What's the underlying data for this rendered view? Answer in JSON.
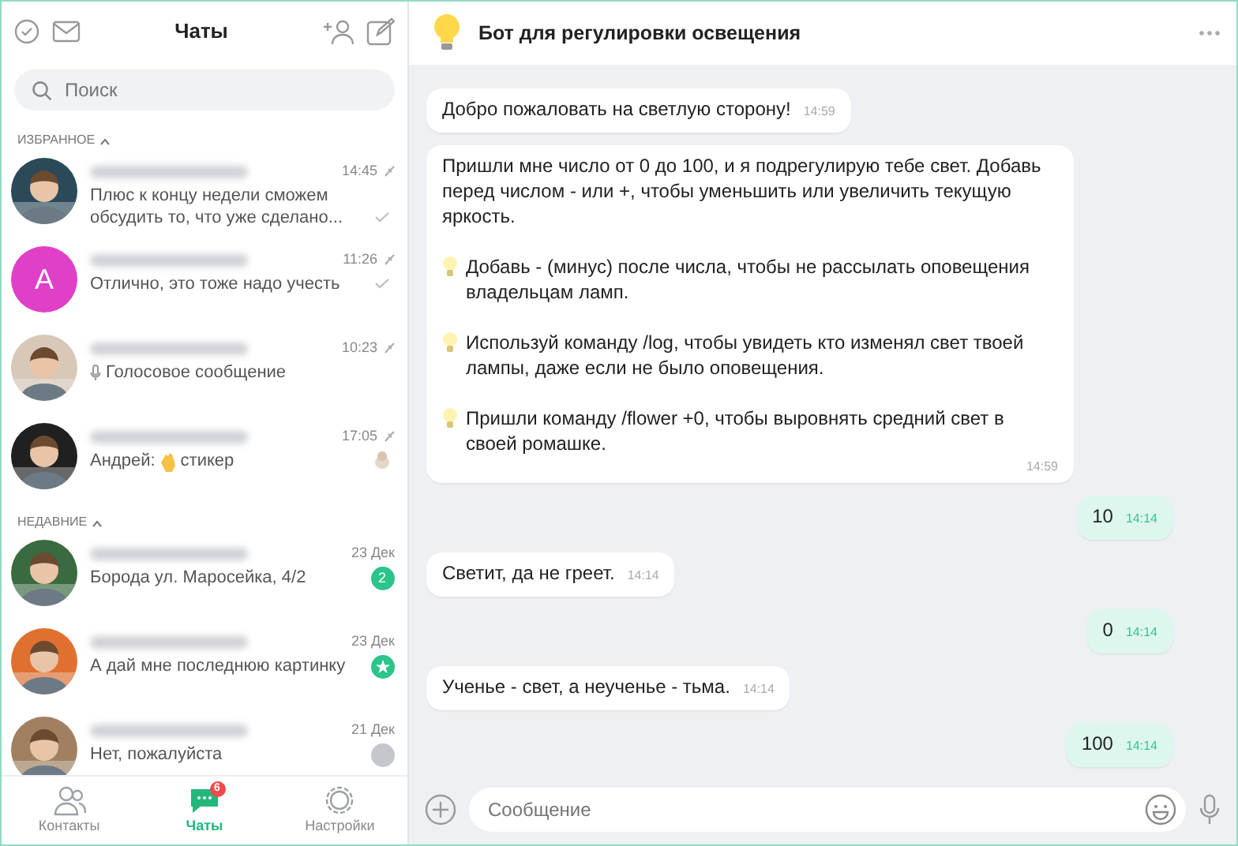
{
  "sidebar": {
    "title": "Чаты",
    "search": {
      "placeholder": "Поиск"
    },
    "sections": [
      {
        "title": "ИЗБРАННОЕ",
        "expanded": true,
        "chats": [
          {
            "message": "Плюс к концу недели сможем обсудить то, что уже сделано...",
            "time": "14:45",
            "pinned": true,
            "indicator": {
              "kind": "read"
            }
          },
          {
            "avatar": {
              "kind": "letter",
              "letter": "А",
              "color": "#e040c8"
            },
            "message": "Отлично, это тоже надо учесть",
            "time": "11:26",
            "pinned": true,
            "indicator": {
              "kind": "read"
            }
          },
          {
            "prefix": {
              "kind": "voice"
            },
            "message": "Голосовое сообщение",
            "time": "10:23",
            "pinned": true
          },
          {
            "sender": "Андрей:",
            "prefix": {
              "kind": "sticker"
            },
            "message": "стикер",
            "time": "17:05",
            "pinned": true,
            "indicator": {
              "kind": "thumbnail"
            }
          }
        ]
      },
      {
        "title": "НЕДАВНИЕ",
        "expanded": true,
        "chats": [
          {
            "message": "Борода ул. Маросейка, 4/2",
            "time": "23 Дек",
            "pinned": false,
            "indicator": {
              "kind": "count",
              "count": "2"
            }
          },
          {
            "message": "А дай мне последнюю картинку",
            "time": "23 Дек",
            "pinned": false,
            "indicator": {
              "kind": "mention"
            }
          },
          {
            "message": "Нет, пожалуйста",
            "time": "21 Дек",
            "pinned": false,
            "indicator": {
              "kind": "muted"
            }
          }
        ]
      }
    ]
  },
  "tabs": [
    {
      "label": "Контакты",
      "kind": "contacts",
      "selected": false
    },
    {
      "label": "Чаты",
      "kind": "chats",
      "selected": true,
      "badge": "6"
    },
    {
      "label": "Настройки",
      "kind": "settings",
      "selected": false
    }
  ],
  "chat": {
    "title": "Бот для регулировки освещения",
    "messages": [
      {
        "kind": "incoming",
        "paragraphs": [
          {
            "text": "Добро пожаловать на светлую сторону!",
            "bulb": false
          }
        ],
        "time": "14:59"
      },
      {
        "kind": "incoming",
        "paragraphs": [
          {
            "text": "Пришли мне число от 0 до 100, и я подрегулирую тебе свет. Добавь перед числом - или +, чтобы уменьшить или увеличить текущую яркость.",
            "bulb": false
          },
          {
            "text": "Добавь - (минус) после числа, чтобы не рассылать оповещения владельцам ламп.",
            "bulb": true
          },
          {
            "text": "Используй команду /log, чтобы увидеть кто изменял свет твоей лампы, даже если не было оповещения.",
            "bulb": true
          },
          {
            "text": "Пришли команду /flower +0, чтобы выровнять средний свет в своей ромашке.",
            "bulb": true
          }
        ],
        "time": "14:59"
      },
      {
        "kind": "outgoing",
        "paragraphs": [
          {
            "text": "10",
            "bulb": false
          }
        ],
        "time": "14:14"
      },
      {
        "kind": "incoming",
        "paragraphs": [
          {
            "text": "Светит, да не греет.",
            "bulb": false
          }
        ],
        "time": "14:14"
      },
      {
        "kind": "outgoing",
        "paragraphs": [
          {
            "text": "0",
            "bulb": false
          }
        ],
        "time": "14:14"
      },
      {
        "kind": "incoming",
        "paragraphs": [
          {
            "text": "Ученье - свет, а неученье - тьма.",
            "bulb": false
          }
        ],
        "time": "14:14"
      },
      {
        "kind": "outgoing",
        "paragraphs": [
          {
            "text": "100",
            "bulb": false
          }
        ],
        "time": "14:14"
      }
    ],
    "composer": {
      "placeholder": "Сообщение"
    }
  }
}
